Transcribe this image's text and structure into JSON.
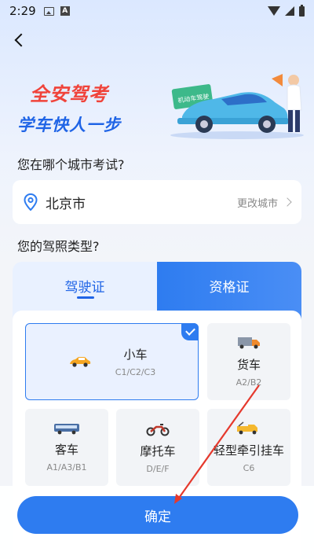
{
  "status_bar": {
    "time": "2:29"
  },
  "banner": {
    "line1": "全安驾考",
    "line2": "学车快人一步",
    "sign_text": "机动车驾驶"
  },
  "city_section": {
    "question": "您在哪个城市考试?",
    "city": "北京市",
    "change_label": "更改城市"
  },
  "license_section": {
    "question": "您的驾照类型?"
  },
  "tabs": [
    {
      "label": "驾驶证",
      "active": true
    },
    {
      "label": "资格证",
      "active": false
    }
  ],
  "options": [
    {
      "name": "小车",
      "codes": "C1/C2/C3",
      "icon": "car-icon",
      "selected": true
    },
    {
      "name": "货车",
      "codes": "A2/B2",
      "icon": "truck-icon",
      "selected": false
    },
    {
      "name": "客车",
      "codes": "A1/A3/B1",
      "icon": "bus-icon",
      "selected": false
    },
    {
      "name": "摩托车",
      "codes": "D/E/F",
      "icon": "motorcycle-icon",
      "selected": false
    },
    {
      "name": "轻型牵引挂车",
      "codes": "C6",
      "icon": "tow-truck-icon",
      "selected": false
    }
  ],
  "confirm_label": "确定",
  "colors": {
    "accent": "#2e7cf0",
    "title_red": "#f0433a",
    "title_blue": "#1f64e6",
    "annotation": "#e5392d"
  }
}
